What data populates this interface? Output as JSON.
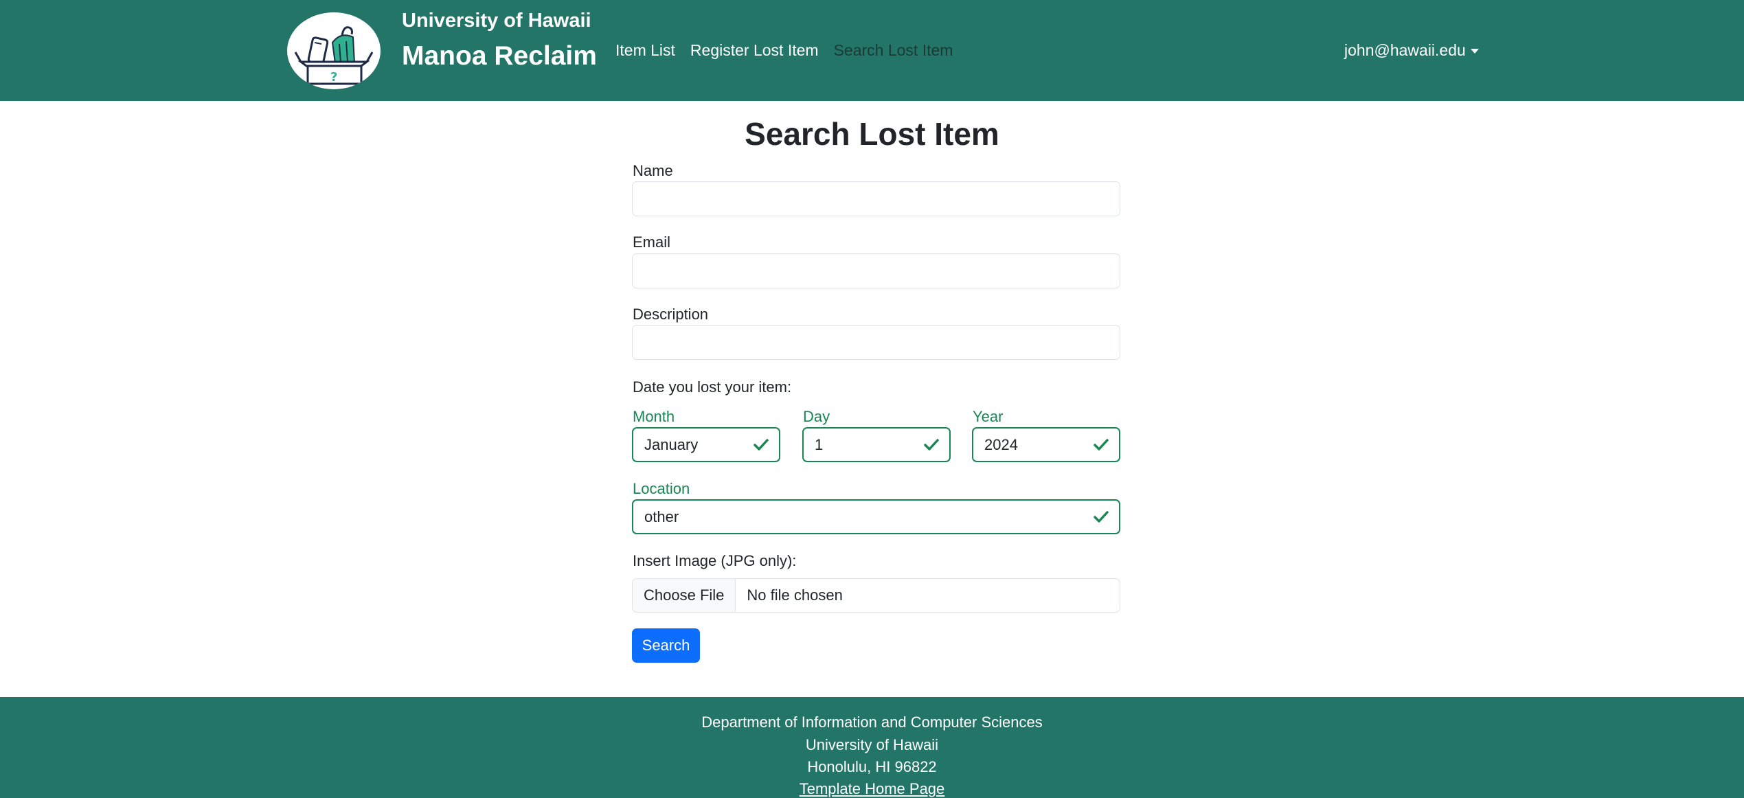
{
  "navbar": {
    "brand_top": "University of Hawaii",
    "brand_main": "Manoa Reclaim",
    "logo_icon": "lost-and-found-box-icon",
    "links": [
      "Item List",
      "Register Lost Item",
      "Search Lost Item"
    ],
    "active_link": "Search Lost Item",
    "user": "john@hawaii.edu",
    "colors": {
      "background": "#237567",
      "text": "#ffffff",
      "active_text": "#1c3a35"
    }
  },
  "form": {
    "title": "Search Lost Item",
    "name_label": "Name",
    "name_value": "",
    "email_label": "Email",
    "email_value": "",
    "description_label": "Description",
    "description_value": "",
    "date_label": "Date you lost your item:",
    "month_label": "Month",
    "month_value": "January",
    "day_label": "Day",
    "day_value": "1",
    "year_label": "Year",
    "year_value": "2024",
    "location_label": "Location",
    "location_value": "other",
    "image_label": "Insert Image (JPG only):",
    "file_button": "Choose File",
    "file_status": "No file chosen",
    "search_button": "Search",
    "colors": {
      "valid": "#198754",
      "primary_button": "#0d6efd"
    }
  },
  "footer": {
    "line1": "Department of Information and Computer Sciences",
    "line2": "University of Hawaii",
    "line3": "Honolulu, HI 96822",
    "link": "Template Home Page",
    "colors": {
      "background": "#237567",
      "text": "#ffffff"
    }
  }
}
